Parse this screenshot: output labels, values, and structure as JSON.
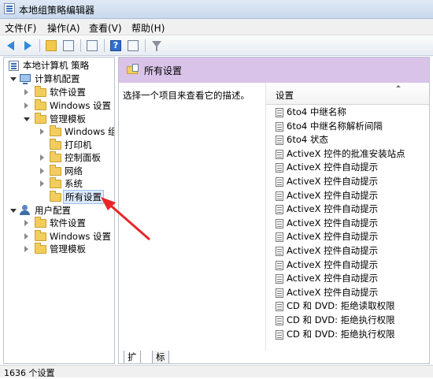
{
  "window": {
    "title": "本地组策略编辑器"
  },
  "menu": [
    {
      "label": "文件(F)"
    },
    {
      "label": "操作(A)"
    },
    {
      "label": "查看(V)"
    },
    {
      "label": "帮助(H)"
    }
  ],
  "toolbar": {
    "buttons": [
      "back-icon",
      "forward-icon",
      "up-folder-icon",
      "show-hide-tree-icon",
      "export-list-icon",
      "help-icon",
      "properties-icon",
      "filter-icon"
    ]
  },
  "tree": {
    "root": "本地计算机 策略",
    "computer_config": "计算机配置",
    "computer_children": [
      "软件设置",
      "Windows 设置",
      "管理模板"
    ],
    "admin_templates_children": [
      "Windows 组件",
      "打印机",
      "控制面板",
      "网络",
      "系统",
      "所有设置"
    ],
    "user_config": "用户配置",
    "user_children": [
      "软件设置",
      "Windows 设置",
      "管理模板"
    ]
  },
  "detail": {
    "header_title": "所有设置",
    "description": "选择一个项目来查看它的描述。",
    "column_header": "设置",
    "rows": [
      "6to4 中继名称",
      "6to4 中继名称解析间隔",
      "6to4 状态",
      "ActiveX 控件的批准安装站点",
      "ActiveX 控件自动提示",
      "ActiveX 控件自动提示",
      "ActiveX 控件自动提示",
      "ActiveX 控件自动提示",
      "ActiveX 控件自动提示",
      "ActiveX 控件自动提示",
      "ActiveX 控件自动提示",
      "ActiveX 控件自动提示",
      "ActiveX 控件自动提示",
      "ActiveX 控件自动提示",
      "CD 和 DVD: 拒绝读取权限",
      "CD 和 DVD: 拒绝执行权限",
      "CD 和 DVD: 拒绝执行权限"
    ],
    "tabs": [
      "扩展",
      "标准"
    ]
  },
  "status": {
    "text": "1636 个设置"
  },
  "colors": {
    "header_bg": "#d9c3e8",
    "annotation_arrow": "#e8262a",
    "selection_bg": "#dbe9fa"
  }
}
